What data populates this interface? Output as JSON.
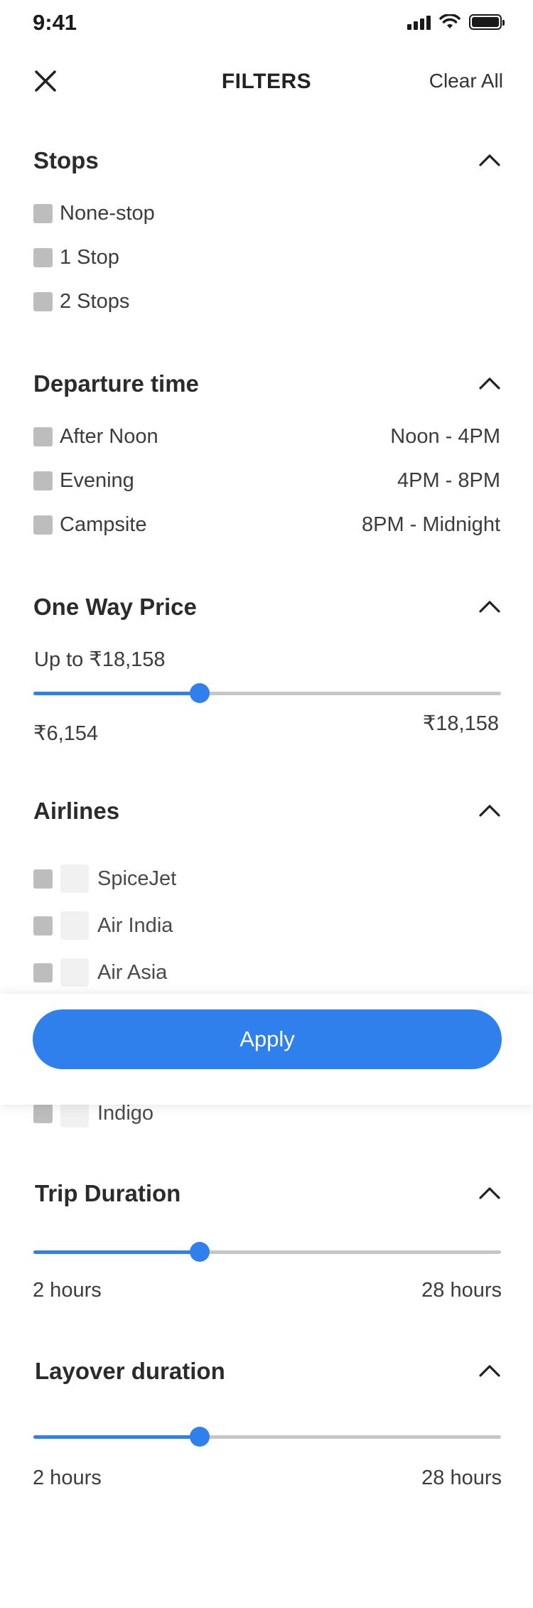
{
  "status_bar": {
    "time": "9:41"
  },
  "header": {
    "title": "FILTERS",
    "clear_label": "Clear All"
  },
  "stops": {
    "title": "Stops",
    "options": [
      {
        "label": "None-stop",
        "checked": false
      },
      {
        "label": "1 Stop",
        "checked": false
      },
      {
        "label": "2 Stops",
        "checked": false
      }
    ]
  },
  "departure": {
    "title": "Departure time",
    "options": [
      {
        "label": "After Noon",
        "range": "Noon - 4PM",
        "checked": false
      },
      {
        "label": "Evening",
        "range": "4PM - 8PM",
        "checked": false
      },
      {
        "label": "Campsite",
        "range": "8PM - Midnight",
        "checked": false
      }
    ]
  },
  "price": {
    "title": "One Way Price",
    "current": "Up to ₹18,158",
    "min_label": "₹6,154",
    "max_label": "₹18,158",
    "slider_fraction": 0.355
  },
  "airlines": {
    "title": "Airlines",
    "items": [
      {
        "label": "SpiceJet",
        "checked": false
      },
      {
        "label": "Air India",
        "checked": false
      },
      {
        "label": "Air Asia",
        "checked": false
      },
      {
        "label": "Indigo",
        "checked": false
      }
    ]
  },
  "apply": {
    "label": "Apply"
  },
  "trip_duration": {
    "title": "Trip Duration",
    "min_label": "2 hours",
    "max_label": "28 hours",
    "slider_fraction": 0.355
  },
  "layover_duration": {
    "title": "Layover duration",
    "min_label": "2 hours",
    "max_label": "28 hours",
    "slider_fraction": 0.355
  },
  "colors": {
    "accent": "#2f80ed",
    "checkbox": "#bdbdbd",
    "track": "#c6c6c6"
  }
}
